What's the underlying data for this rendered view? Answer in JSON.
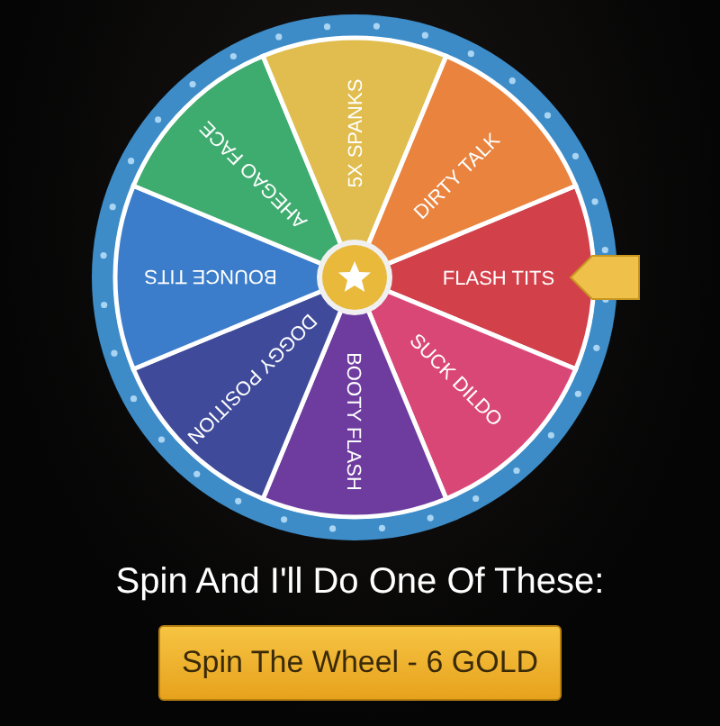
{
  "wheel": {
    "segments": [
      {
        "label": "FLASH TITS",
        "color": "#d2404a"
      },
      {
        "label": "SUCK DILDO",
        "color": "#d94777"
      },
      {
        "label": "BOOTY FLASH",
        "color": "#6e3c9f"
      },
      {
        "label": "DOGGY POSITION",
        "color": "#3f4a9a"
      },
      {
        "label": "BOUNCE TITS",
        "color": "#3b7dca"
      },
      {
        "label": "AHEGAO FACE",
        "color": "#3eab6f"
      },
      {
        "label": "5X SPANKS",
        "color": "#e0bd4e"
      },
      {
        "label": "DIRTY TALK",
        "color": "#e9833e"
      }
    ]
  },
  "caption": "Spin And I'll Do One Of These:",
  "button": {
    "label": "Spin The Wheel - 6 GOLD"
  }
}
